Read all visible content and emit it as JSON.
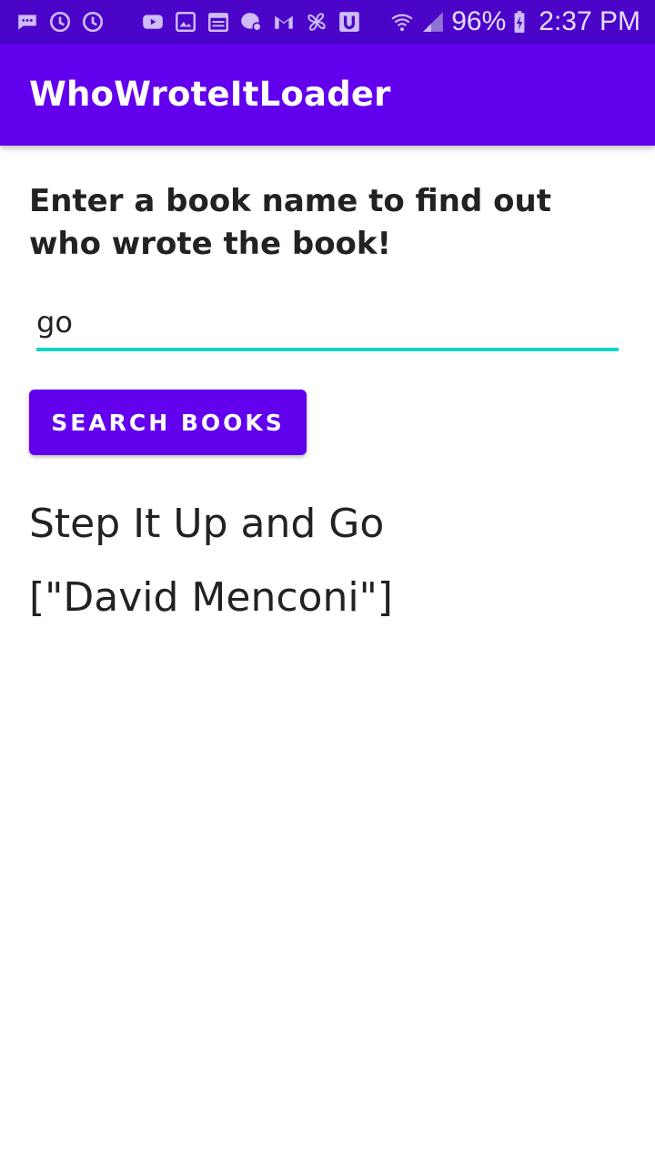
{
  "status_bar": {
    "battery_percent": "96%",
    "time": "2:37 PM",
    "left_icons": [
      "chat-bubble-icon",
      "sync-icon",
      "sync-icon",
      "youtube-icon",
      "image-icon",
      "calendar-icon",
      "messenger-icon",
      "gmail-icon",
      "pinwheel-icon",
      "u-app-icon"
    ],
    "right_icons": [
      "wifi-icon",
      "cell-signal-icon",
      "battery-charging-icon"
    ]
  },
  "app_bar": {
    "title": "WhoWroteItLoader"
  },
  "main": {
    "prompt": "Enter a book name to find out who wrote the book!",
    "input_value": "go",
    "search_button_label": "SEARCH BOOKS",
    "result_title": "Step It Up and Go",
    "result_authors": "[\"David Menconi\"]"
  },
  "colors": {
    "status_bar": "#4a05c9",
    "primary": "#6200ee",
    "accent": "#14d3c8",
    "text": "#222222"
  }
}
